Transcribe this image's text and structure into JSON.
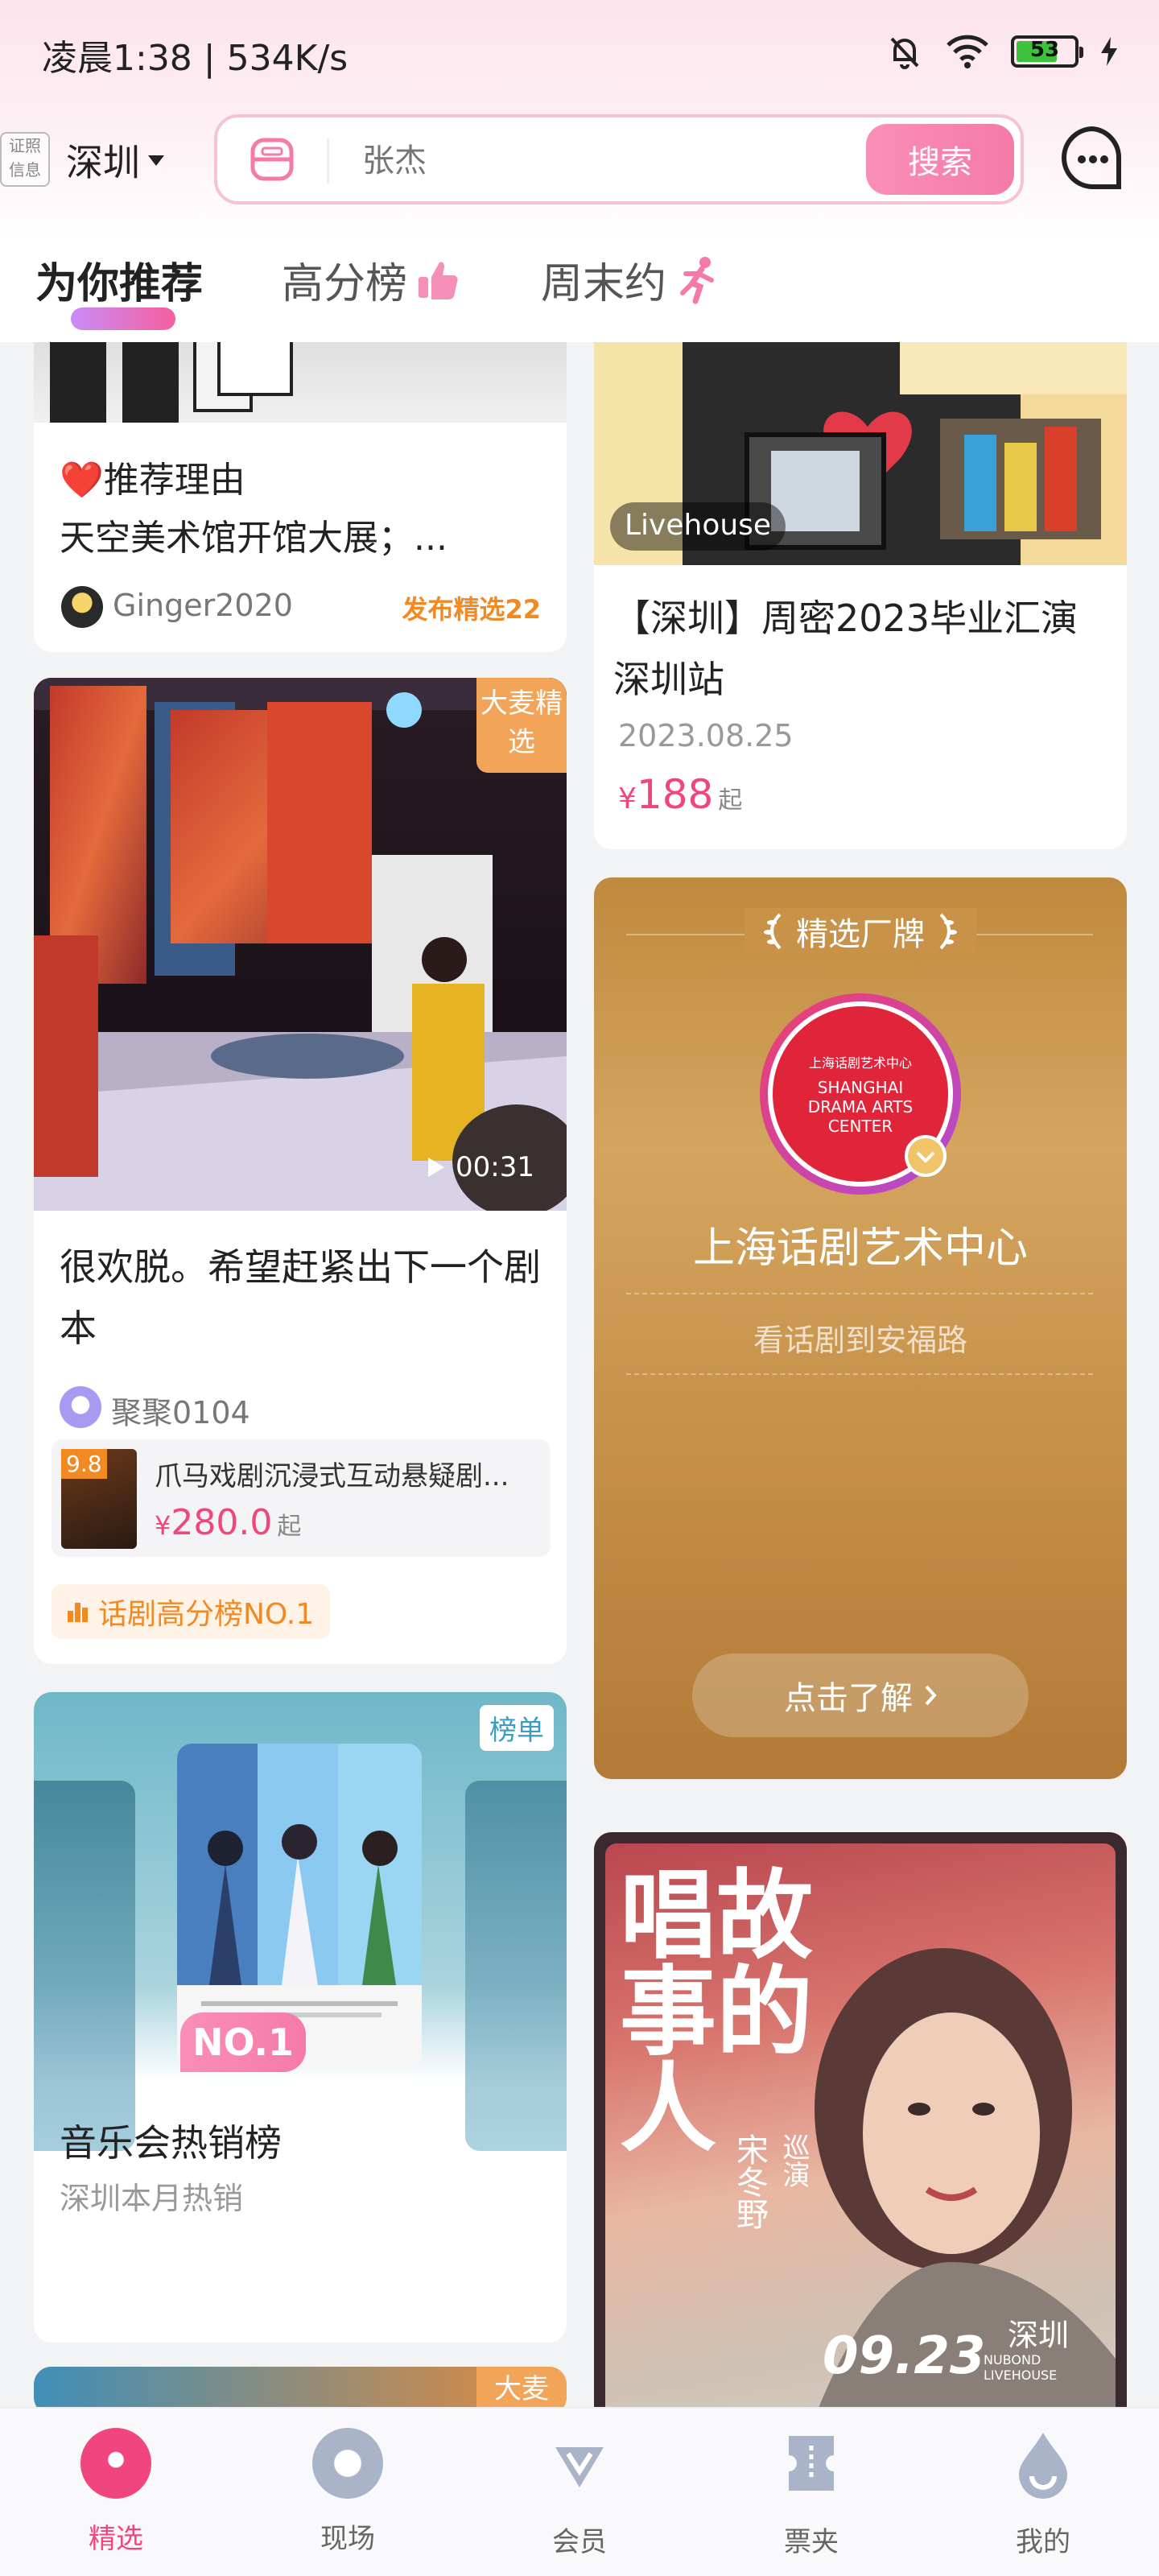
{
  "status_bar": {
    "time": "凌晨1:38 | 534K/s",
    "battery": "53"
  },
  "header": {
    "license_label": "证照信息",
    "city": "深圳",
    "search_placeholder": "张杰",
    "search_button": "搜索"
  },
  "tabs": [
    {
      "label": "为你推荐"
    },
    {
      "label": "高分榜"
    },
    {
      "label": "周末约"
    }
  ],
  "cards": {
    "reason_card": {
      "title": "❤️推荐理由",
      "text": "天空美术馆开馆大展；...",
      "user": "Ginger2020",
      "tag": "发布精选22"
    },
    "livehouse_card": {
      "image_tag": "Livehouse",
      "title": "【深圳】周密2023毕业汇演深圳站",
      "date": "2023.08.25",
      "price_symbol": "¥",
      "price": "188",
      "price_suffix": "起"
    },
    "video_card": {
      "badge": "大麦精选",
      "duration": "00:31",
      "title": "很欢脱。希望赶紧出下一个剧本",
      "user": "聚聚0104",
      "show_score": "9.8",
      "show_title": "爪马戏剧沉浸式互动悬疑剧...",
      "show_price_symbol": "¥",
      "show_price": "280.0",
      "show_price_suffix": "起",
      "rank_tag": "话剧高分榜NO.1"
    },
    "brand_card": {
      "header": "精选厂牌",
      "logo_cn": "上海话剧艺术中心",
      "logo_en": "SHANGHAI DRAMA ARTS CENTER",
      "name": "上海话剧艺术中心",
      "slogan": "看话剧到安福路",
      "button": "点击了解"
    },
    "chart_card": {
      "badge": "榜单",
      "rank": "NO.1",
      "title": "音乐会热销榜",
      "subtitle": "深圳本月热销"
    },
    "poster_card": {
      "poster_title": "唱故事的人",
      "poster_artist": "宋冬野",
      "poster_tour": "巡演",
      "poster_date": "09.23",
      "poster_city": "深圳",
      "poster_venue": "NUBOND LIVEHOUSE"
    },
    "partial_card": {
      "badge": "大麦"
    }
  },
  "bottom_nav": [
    {
      "label": "精选"
    },
    {
      "label": "现场"
    },
    {
      "label": "会员"
    },
    {
      "label": "票夹"
    },
    {
      "label": "我的"
    }
  ],
  "colors": {
    "accent": "#f0457f",
    "price": "#f0457f",
    "tag_orange": "#f28a24"
  }
}
